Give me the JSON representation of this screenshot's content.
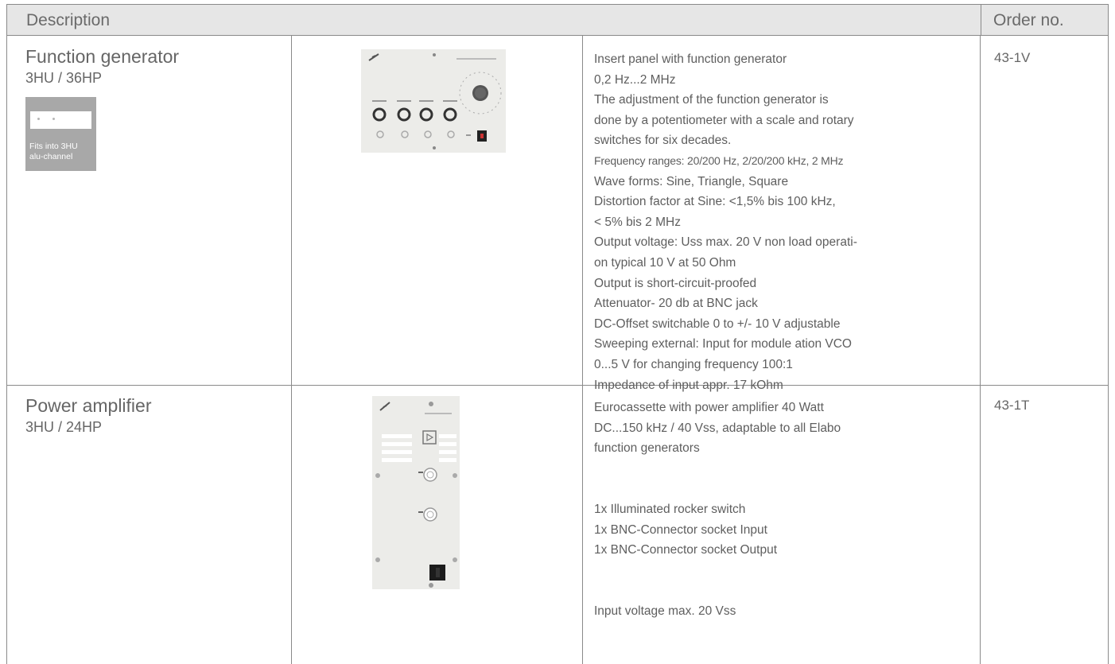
{
  "header": {
    "description": "Description",
    "order_no": "Order no."
  },
  "products": [
    {
      "name": "Function generator",
      "size": "3HU / 36HP",
      "badge": {
        "line1": "Fits into 3HU",
        "line2": "alu-channel"
      },
      "order_no": "43-1V",
      "spec": [
        "Insert panel with function generator",
        "0,2 Hz...2 MHz",
        "The adjustment of the function generator is",
        "done by a potentiometer with a scale and rotary",
        "switches for six decades.",
        "Frequency ranges: 20/200 Hz, 2/20/200 kHz, 2 MHz",
        "Wave forms: Sine, Triangle, Square",
        "Distortion factor at Sine: <1,5% bis 100 kHz,",
        "< 5% bis 2 MHz",
        "Output voltage: Uss max. 20 V non load operati-",
        "on typical 10 V at 50 Ohm",
        "Output is short-circuit-proofed",
        "Attenuator- 20 db at BNC jack",
        "DC-Offset switchable 0 to +/- 10 V adjustable",
        "Sweeping external: Input for module ation VCO",
        "0...5 V for changing frequency 100:1",
        "Impedance of input appr. 17 kOhm"
      ]
    },
    {
      "name": "Power amplifier",
      "size": "3HU / 24HP",
      "order_no": "43-1T",
      "spec": [
        "Eurocassette with power amplifier 40 Watt",
        "DC...150 kHz / 40 Vss, adaptable to all Elabo",
        "function generators",
        "",
        "",
        "1x Illuminated rocker switch",
        "1x BNC-Connector socket Input",
        "1x BNC-Connector socket Output",
        "",
        "",
        "Input voltage max. 20 Vss"
      ]
    }
  ]
}
